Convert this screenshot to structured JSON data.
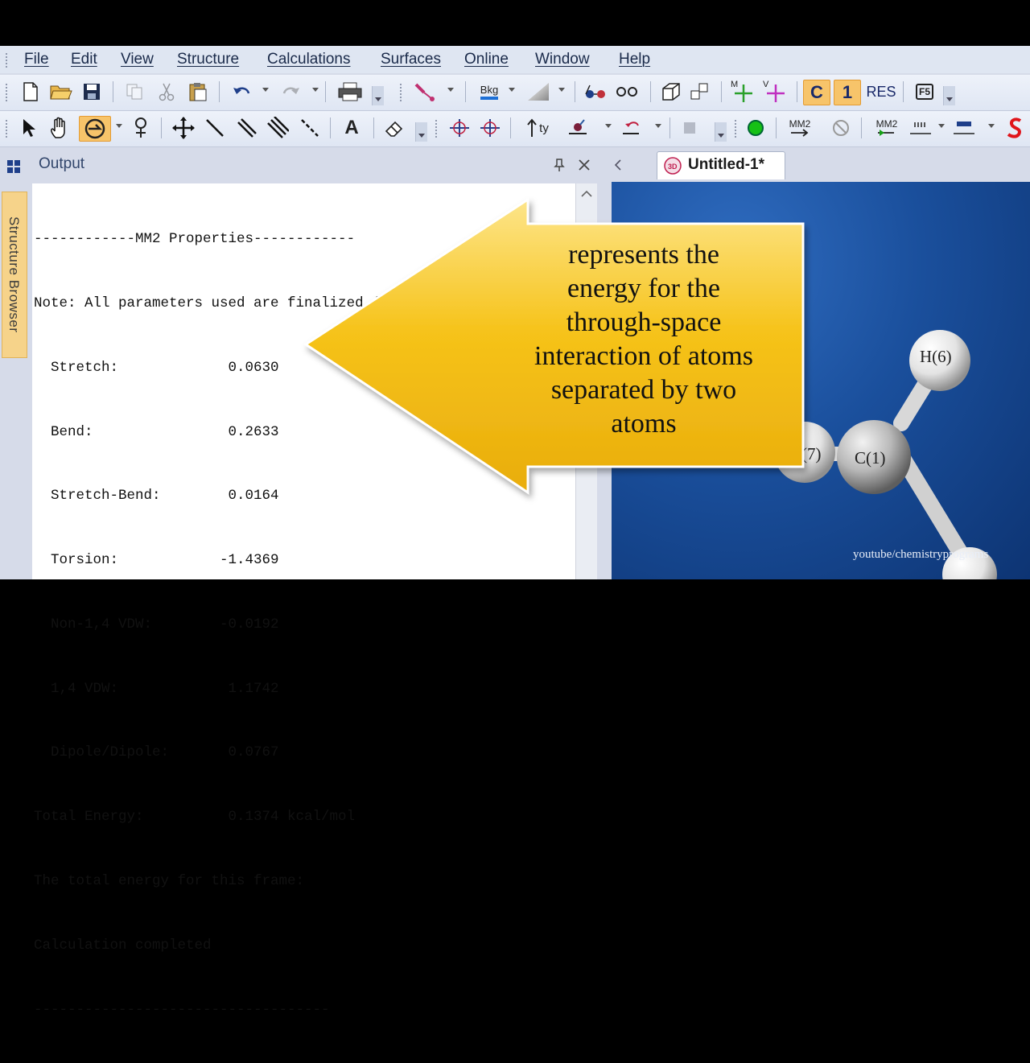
{
  "menu": [
    "File",
    "Edit",
    "View",
    "Structure",
    "Calculations",
    "Surfaces",
    "Online",
    "Window",
    "Help"
  ],
  "toolbar1": {
    "bkg_label": "Bkg",
    "mm_label": "M",
    "vm_label": "V",
    "c_label": "C",
    "one_label": "1",
    "res_label": "RES",
    "fs_label": "F5"
  },
  "toolbar2": {
    "text_tool": "A",
    "ty_label": "ty",
    "mm2_label_a": "MM2",
    "mm2_label_b": "MM2"
  },
  "side": {
    "structure_browser_label": "Structure Browser"
  },
  "output": {
    "title": "Output",
    "lines": [
      "------------MM2 Properties------------",
      "Note: All parameters used are finalized (Quality = 4).",
      "  Stretch:             0.0630",
      "  Bend:                0.2633",
      "  Stretch-Bend:        0.0164",
      "  Torsion:            -1.4369",
      "  Non-1,4 VDW:        -0.0192",
      "  1,4 VDW:             1.1742",
      "  Dipole/Dipole:       0.0767",
      "Total Energy:          0.1374 kcal/mol",
      "The total energy for this frame:",
      "Calculation completed",
      "-----------------------------------"
    ]
  },
  "document": {
    "tab_label": "Untitled-1*",
    "atoms": {
      "h6": "H(6)",
      "c1": "C(1)",
      "h7": "(7)"
    }
  },
  "callout": {
    "lines": [
      "represents the",
      "energy for the",
      "through-space",
      "interaction of atoms",
      "separated by two",
      "atoms"
    ],
    "fill_color": "#f6c31a"
  },
  "watermark": "youtube/chemistryprograms"
}
